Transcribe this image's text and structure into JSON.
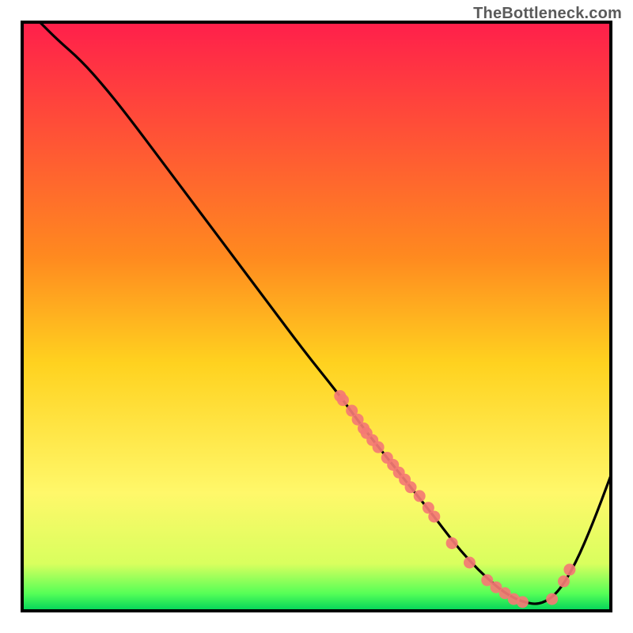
{
  "attribution": "TheBottleneck.com",
  "chart_data": {
    "type": "line",
    "title": "",
    "xlabel": "",
    "ylabel": "",
    "xlim": [
      0,
      100
    ],
    "ylim": [
      0,
      100
    ],
    "grid": false,
    "legend": false,
    "gradient_stops": [
      {
        "offset": 0,
        "color": "#ff1f4b"
      },
      {
        "offset": 40,
        "color": "#ff8a1f"
      },
      {
        "offset": 58,
        "color": "#ffd21f"
      },
      {
        "offset": 80,
        "color": "#fff86a"
      },
      {
        "offset": 92,
        "color": "#d9ff5e"
      },
      {
        "offset": 97,
        "color": "#57ff57"
      },
      {
        "offset": 100,
        "color": "#00d45a"
      }
    ],
    "series": [
      {
        "name": "bottleneck-curve",
        "type": "line",
        "color": "#000000",
        "x": [
          3,
          6,
          10,
          14,
          18,
          24,
          30,
          36,
          42,
          48,
          54,
          58,
          62,
          66,
          70,
          73,
          76,
          79,
          82,
          85,
          88,
          91,
          94,
          97,
          100
        ],
        "y": [
          100,
          97,
          93.5,
          89,
          84,
          76,
          68,
          60,
          52,
          44,
          36.5,
          31,
          26,
          21,
          16,
          12,
          8.5,
          5.5,
          3,
          1.5,
          1,
          3,
          8,
          15,
          23
        ]
      },
      {
        "name": "highlight-points",
        "type": "scatter",
        "color": "#f47a74",
        "x": [
          54,
          54.5,
          56,
          57,
          58,
          58.5,
          59.5,
          60.5,
          62,
          63,
          64,
          65,
          66,
          67.5,
          69,
          70,
          73,
          76,
          79,
          80.5,
          82,
          83.5,
          85,
          90,
          92,
          93
        ],
        "y": [
          36.5,
          35.8,
          34,
          32.5,
          31,
          30.2,
          29,
          27.8,
          26,
          24.8,
          23.5,
          22.3,
          21,
          19.5,
          17.5,
          16,
          11.5,
          8.2,
          5.2,
          4,
          3,
          2,
          1.5,
          2,
          5,
          7
        ]
      }
    ]
  }
}
